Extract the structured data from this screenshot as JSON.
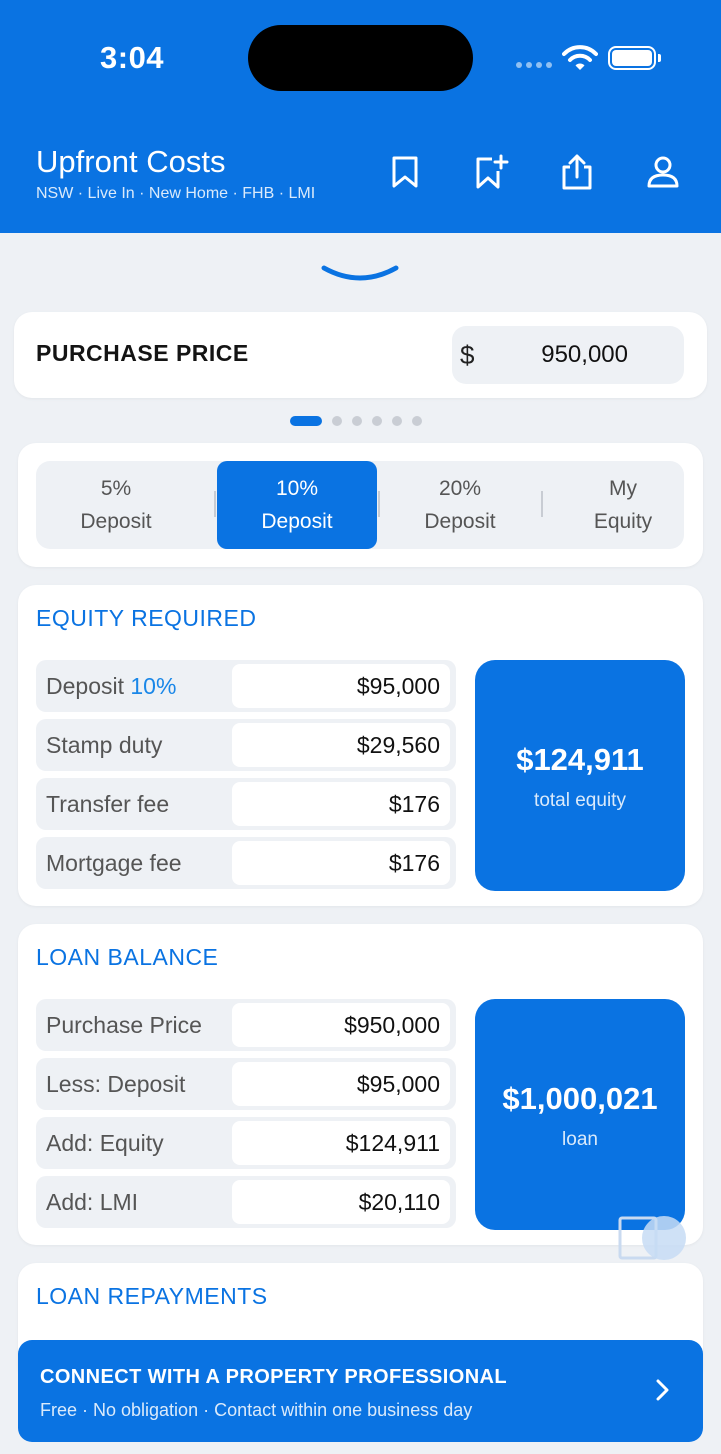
{
  "status_bar": {
    "time": "3:04"
  },
  "header": {
    "title": "Upfront Costs",
    "subtitle": "NSW · Live In · New Home · FHB · LMI",
    "icons": [
      "bookmark-icon",
      "bookmark-add-icon",
      "share-icon",
      "profile-icon"
    ]
  },
  "purchase_price": {
    "label": "PURCHASE PRICE",
    "currency": "$",
    "value": "950,000"
  },
  "pager": {
    "total": 6,
    "active_index": 0
  },
  "deposit_tabs": [
    {
      "line1": "5%",
      "line2": "Deposit"
    },
    {
      "line1": "10%",
      "line2": "Deposit"
    },
    {
      "line1": "20%",
      "line2": "Deposit"
    },
    {
      "line1": "My",
      "line2": "Equity"
    }
  ],
  "selected_tab": 1,
  "equity": {
    "title": "EQUITY REQUIRED",
    "rows": [
      {
        "label": "Deposit ",
        "accent": "10%",
        "value": "$95,000"
      },
      {
        "label": "Stamp duty",
        "accent": "",
        "value": "$29,560"
      },
      {
        "label": "Transfer fee",
        "accent": "",
        "value": "$176"
      },
      {
        "label": "Mortgage fee",
        "accent": "",
        "value": "$176"
      }
    ],
    "total": "$124,911",
    "total_label": "total equity"
  },
  "loan_balance": {
    "title": "LOAN BALANCE",
    "rows": [
      {
        "label": "Purchase Price",
        "value": "$950,000"
      },
      {
        "label": "Less: Deposit",
        "value": "$95,000"
      },
      {
        "label": "Add: Equity",
        "value": "$124,911"
      },
      {
        "label": "Add: LMI",
        "value": "$20,110"
      }
    ],
    "total": "$1,000,021",
    "total_label": "loan"
  },
  "loan_repayments": {
    "title": "LOAN REPAYMENTS"
  },
  "cta": {
    "title": "CONNECT WITH A PROPERTY PROFESSIONAL",
    "subtitle": "Free · No obligation · Contact within one business day"
  },
  "colors": {
    "brand": "#0a73e2",
    "background": "#eef1f5",
    "accent_text": "#1a87e8"
  }
}
